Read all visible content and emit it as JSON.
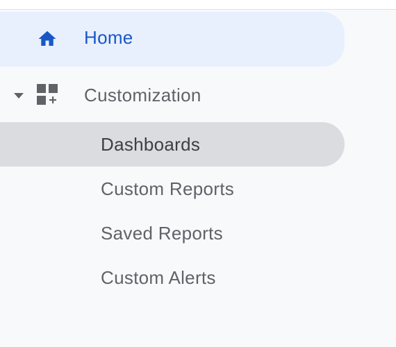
{
  "nav": {
    "home": {
      "label": "Home",
      "icon": "home-icon",
      "active": true
    },
    "customization": {
      "label": "Customization",
      "icon": "dashboard-add-icon",
      "expanded": true,
      "items": [
        {
          "label": "Dashboards",
          "selected": true
        },
        {
          "label": "Custom Reports",
          "selected": false
        },
        {
          "label": "Saved Reports",
          "selected": false
        },
        {
          "label": "Custom Alerts",
          "selected": false
        }
      ]
    }
  },
  "colors": {
    "accent": "#1a57c6",
    "home_bg": "#e8f0fe",
    "selected_bg": "#dadce0",
    "text": "#5f6368",
    "sidebar_bg": "#f8f9fb"
  }
}
